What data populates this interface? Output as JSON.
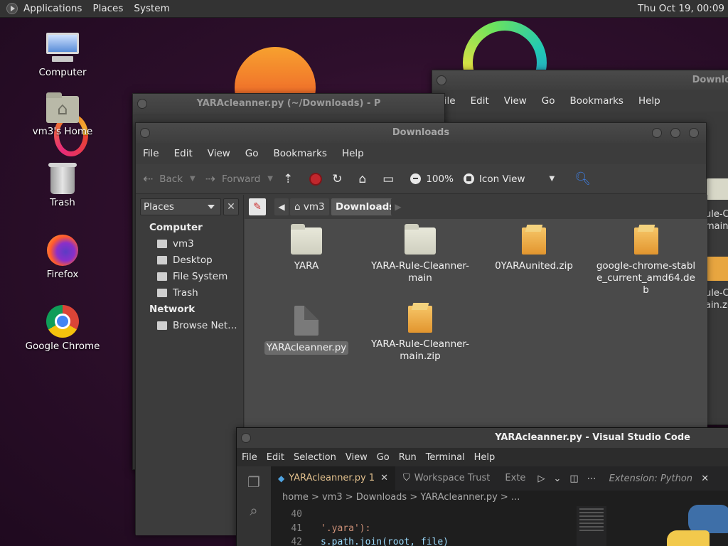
{
  "top_panel": {
    "menus": [
      "Applications",
      "Places",
      "System"
    ],
    "clock": "Thu Oct 19, 00:09"
  },
  "desktop_icons": {
    "computer": "Computer",
    "home": "vm3's Home",
    "trash": "Trash",
    "firefox": "Firefox",
    "chrome": "Google Chrome"
  },
  "back_window": {
    "title": "Downlo",
    "menu": [
      "File",
      "Edit",
      "View",
      "Go",
      "Bookmarks",
      "Help"
    ],
    "partial_items": [
      "ule-Cl",
      "main",
      "ule-Cl",
      "ain.zi"
    ]
  },
  "python_window": {
    "title": "YARAcleanner.py (~/Downloads) - P"
  },
  "main_window": {
    "title": "Downloads",
    "menu": [
      "File",
      "Edit",
      "View",
      "Go",
      "Bookmarks",
      "Help"
    ],
    "toolbar": {
      "back": "Back",
      "forward": "Forward",
      "zoom": "100%",
      "view_mode": "Icon View"
    },
    "sidebar": {
      "selector": "Places",
      "computer_heading": "Computer",
      "computer_items": [
        "vm3",
        "Desktop",
        "File System",
        "Trash"
      ],
      "network_heading": "Network",
      "network_items": [
        "Browse Net…"
      ]
    },
    "pathbar": {
      "crumbs": [
        "vm3",
        "Downloads"
      ]
    },
    "files": [
      {
        "name": "YARA",
        "type": "folder"
      },
      {
        "name": "YARA-Rule-Cleanner-main",
        "type": "folder"
      },
      {
        "name": "0YARAunited.zip",
        "type": "zip"
      },
      {
        "name": "google-chrome-stable_current_amd64.deb",
        "type": "zip"
      },
      {
        "name": "YARAcleanner.py",
        "type": "doc",
        "selected": true
      },
      {
        "name": "YARA-Rule-Cleanner-main.zip",
        "type": "zip"
      }
    ]
  },
  "vscode": {
    "title": "YARAcleanner.py - Visual Studio Code",
    "menu": [
      "File",
      "Edit",
      "Selection",
      "View",
      "Go",
      "Run",
      "Terminal",
      "Help"
    ],
    "tabs": {
      "active": "YARAcleanner.py 1",
      "second": "Workspace Trust",
      "third": "Exte",
      "extension": "Extension: Python"
    },
    "breadcrumbs": "home > vm3 > Downloads > YARAcleanner.py > ...",
    "lines": [
      {
        "num": "40",
        "text": ""
      },
      {
        "num": "41",
        "text": "'.yara'):"
      },
      {
        "num": "42",
        "text": "s.path.join(root, file)"
      }
    ]
  }
}
